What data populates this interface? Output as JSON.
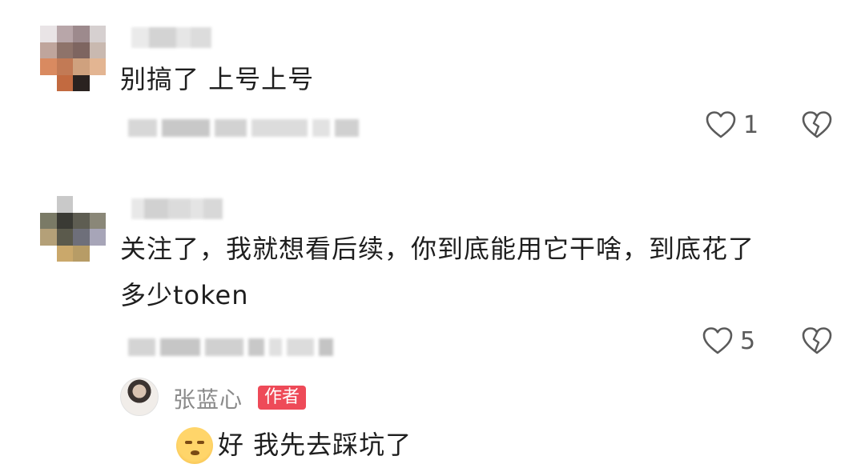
{
  "comments": [
    {
      "text_lines": [
        "别搞了 上号上号"
      ],
      "likes": "1"
    },
    {
      "text_lines": [
        "关注了，我就想看后续，你到底能用它干啥，到底花了",
        "多少token"
      ],
      "likes": "5"
    }
  ],
  "reply": {
    "author": "张蓝心",
    "badge": "作者",
    "text": "好 我先去踩坑了"
  },
  "icons": {
    "like": "heart-outline-icon",
    "dislike": "broken-heart-icon",
    "reply_emoji": "grinning-face-emoji-icon"
  },
  "colors": {
    "badge": "#ee4a58",
    "author_name": "#8a8a8a",
    "text": "#1e1e1e",
    "icon": "#5a5a5a"
  }
}
